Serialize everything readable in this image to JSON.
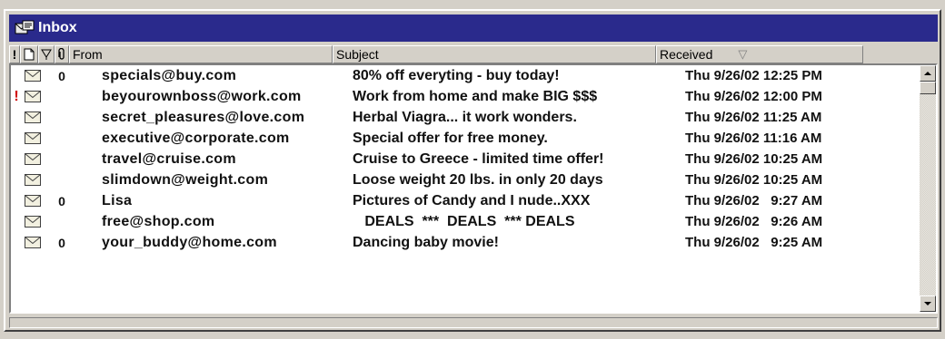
{
  "window": {
    "title": "Inbox",
    "icon": "inbox-icon"
  },
  "columns": {
    "importance_glyph": "!",
    "type_icon": "page-icon",
    "flag_icon": "flag-icon",
    "attachment_icon": "paperclip-icon",
    "from": "From",
    "subject": "Subject",
    "received": "Received",
    "sort_indicator": "▽"
  },
  "messages": [
    {
      "important": "",
      "attachment": "0",
      "from": "specials@buy.com",
      "subject": "80% off everyting - buy today!",
      "received": "Thu 9/26/02 12:25 PM"
    },
    {
      "important": "!",
      "attachment": "",
      "from": "beyourownboss@work.com",
      "subject": "Work from home and make BIG $$$",
      "received": "Thu 9/26/02 12:00 PM"
    },
    {
      "important": "",
      "attachment": "",
      "from": "secret_pleasures@love.com",
      "subject": "Herbal Viagra... it work wonders.",
      "received": "Thu 9/26/02 11:25 AM"
    },
    {
      "important": "",
      "attachment": "",
      "from": "executive@corporate.com",
      "subject": "Special offer for free money.",
      "received": "Thu 9/26/02 11:16 AM"
    },
    {
      "important": "",
      "attachment": "",
      "from": "travel@cruise.com",
      "subject": "Cruise to Greece - limited time offer!",
      "received": "Thu 9/26/02 10:25 AM"
    },
    {
      "important": "",
      "attachment": "",
      "from": "slimdown@weight.com",
      "subject": "Loose weight 20 lbs. in only 20 days",
      "received": "Thu 9/26/02 10:25 AM"
    },
    {
      "important": "",
      "attachment": "0",
      "from": "Lisa",
      "subject": "Pictures of Candy and I nude..XXX",
      "received": "Thu 9/26/02   9:27 AM"
    },
    {
      "important": "",
      "attachment": "",
      "from": "free@shop.com",
      "subject": "   DEALS  ***  DEALS  *** DEALS",
      "received": "Thu 9/26/02   9:26 AM"
    },
    {
      "important": "",
      "attachment": "0",
      "from": "your_buddy@home.com",
      "subject": "Dancing baby movie!",
      "received": "Thu 9/26/02   9:25 AM"
    }
  ],
  "scrollbar": {
    "up_icon": "scroll-up-arrow-icon",
    "down_icon": "scroll-down-arrow-icon"
  },
  "colors": {
    "titlebar": "#2a2a8c",
    "importance": "#d00000",
    "window": "#d4d0c8"
  }
}
